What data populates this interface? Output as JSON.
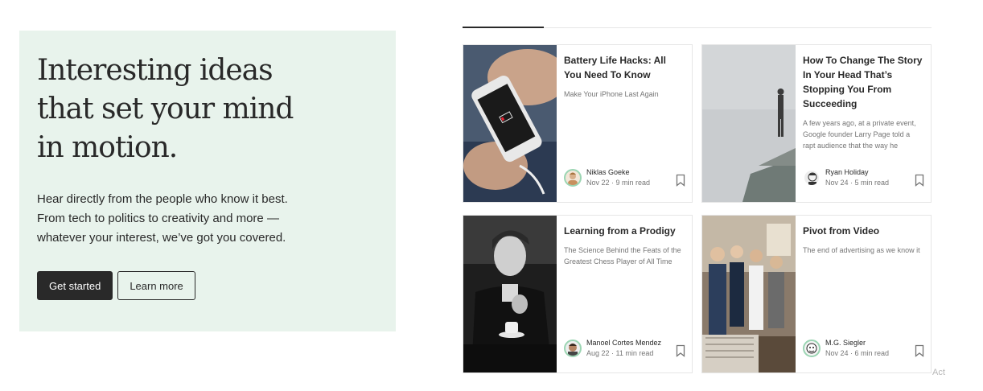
{
  "hero": {
    "title": "Interesting ideas that set your mind in motion.",
    "description": "Hear directly from the people who know it best. From tech to politics to creativity and more — whatever your interest, we’ve got you covered.",
    "primary_button": "Get started",
    "secondary_button": "Learn more"
  },
  "cards": [
    {
      "title": "Battery Life Hacks: All You Need To Know",
      "subtitle": "Make Your iPhone Last Again",
      "author": "Niklas Goeke",
      "date": "Nov 22",
      "read_time": "9 min read"
    },
    {
      "title": "How To Change The Story In Your Head That’s Stopping You From Succeeding",
      "subtitle": "A few years ago, at a private event, Google founder Larry Page told a rapt audience that the way he evaluates…",
      "author": "Ryan Holiday",
      "date": "Nov 24",
      "read_time": "5 min read"
    },
    {
      "title": "Learning from a Prodigy",
      "subtitle": "The Science Behind the Feats of the Greatest Chess Player of All Time",
      "author": "Manoel Cortes Mendez",
      "date": "Aug 22",
      "read_time": "11 min read"
    },
    {
      "title": "Pivot from Video",
      "subtitle": "The end of advertising as we know it",
      "author": "M.G. Siegler",
      "date": "Nov 24",
      "read_time": "6 min read"
    }
  ],
  "meta_separator": " · ",
  "footer_fragment": "Act",
  "icons": {
    "bookmark": "bookmark-icon",
    "avatar": "author-avatar"
  },
  "colors": {
    "hero_bg": "#e8f3ec",
    "primary_button": "#292929",
    "avatar_ring": "#9bd5b3"
  }
}
